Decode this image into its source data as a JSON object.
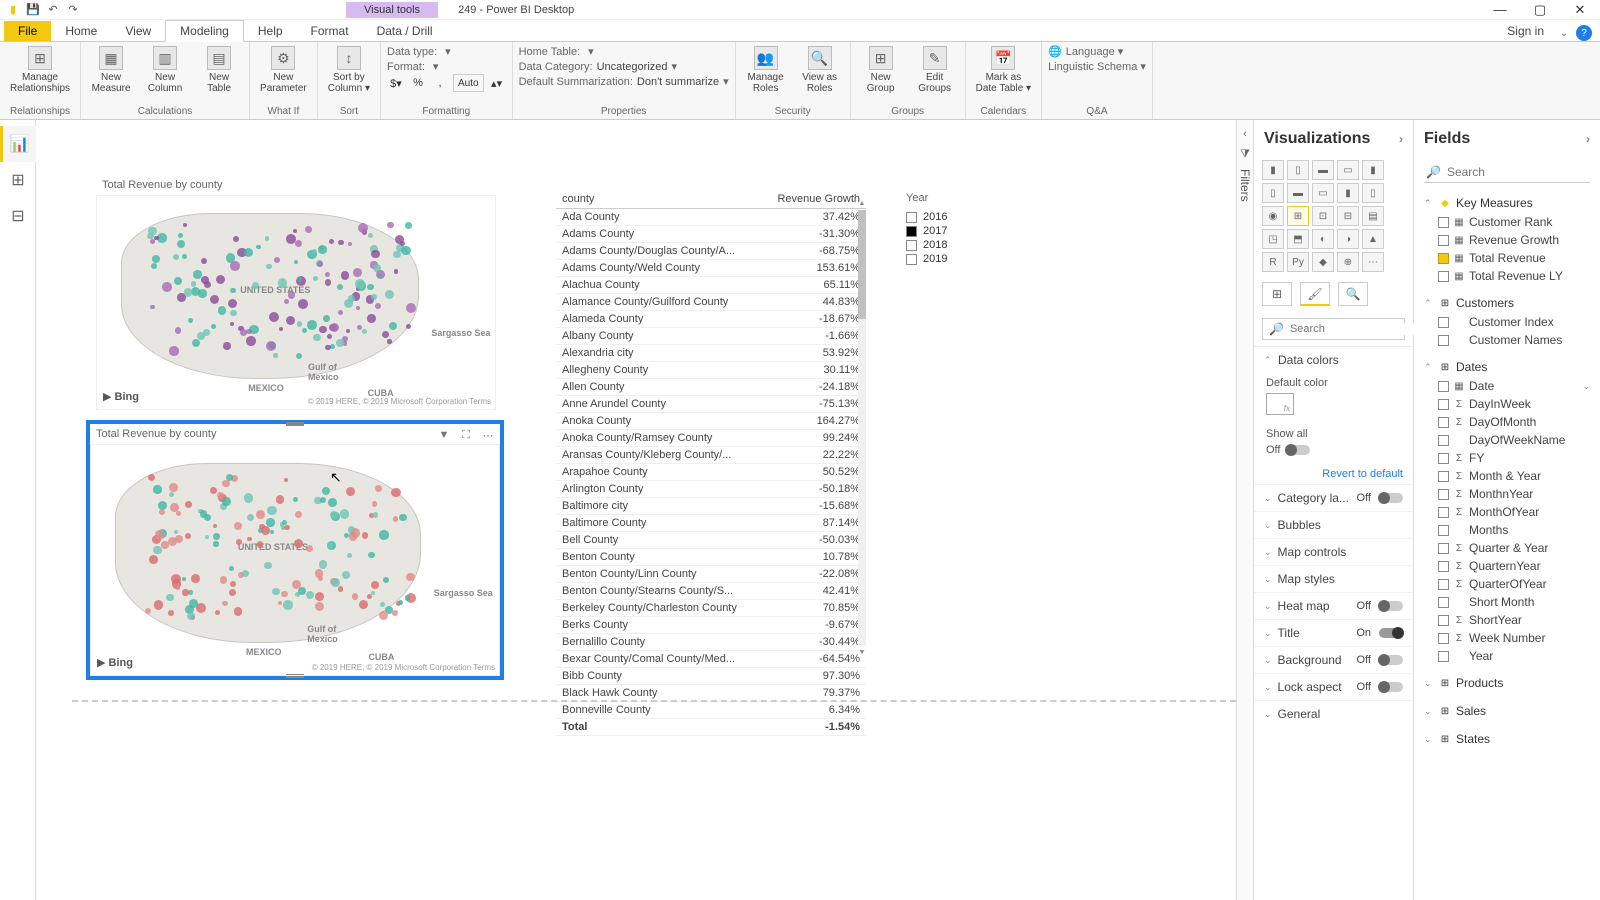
{
  "titlebar": {
    "visual_tools": "Visual tools",
    "app_title": "249 - Power BI Desktop"
  },
  "tabs": {
    "file": "File",
    "home": "Home",
    "view": "View",
    "modeling": "Modeling",
    "help": "Help",
    "format": "Format",
    "data_drill": "Data / Drill",
    "signin": "Sign in"
  },
  "ribbon": {
    "relationships": {
      "manage": "Manage\nRelationships",
      "group": "Relationships"
    },
    "calculations": {
      "measure": "New\nMeasure",
      "column": "New\nColumn",
      "table": "New\nTable",
      "group": "Calculations"
    },
    "whatif": {
      "param": "New\nParameter",
      "group": "What If"
    },
    "sort": {
      "sortby": "Sort by\nColumn ▾",
      "group": "Sort"
    },
    "formatting": {
      "datatype_lbl": "Data type:",
      "datatype_val": "",
      "format_lbl": "Format:",
      "format_val": "",
      "auto": "Auto",
      "group": "Formatting"
    },
    "properties": {
      "hometable_lbl": "Home Table:",
      "hometable_val": "",
      "datacat_lbl": "Data Category:",
      "datacat_val": "Uncategorized",
      "defsum_lbl": "Default Summarization:",
      "defsum_val": "Don't summarize",
      "group": "Properties"
    },
    "security": {
      "roles": "Manage\nRoles",
      "viewas": "View as\nRoles",
      "group": "Security"
    },
    "groups": {
      "new": "New\nGroup",
      "edit": "Edit\nGroups",
      "group": "Groups"
    },
    "calendars": {
      "mark": "Mark as\nDate Table ▾",
      "group": "Calendars"
    },
    "qa": {
      "lang": "Language ▾",
      "schema": "Linguistic Schema ▾",
      "group": "Q&A"
    }
  },
  "map_title": "Total Revenue by county",
  "map_labels": {
    "us": "UNITED STATES",
    "mexico": "MEXICO",
    "gulf": "Gulf of\nMexico",
    "cuba": "CUBA",
    "sargasso": "Sargasso Sea"
  },
  "bing": "Bing",
  "attrib": "© 2019 HERE, © 2019 Microsoft Corporation  Terms",
  "table": {
    "col1": "county",
    "col2": "Revenue Growth",
    "rows": [
      [
        "Ada County",
        "37.42%"
      ],
      [
        "Adams County",
        "-31.30%"
      ],
      [
        "Adams County/Douglas County/A...",
        "-68.75%"
      ],
      [
        "Adams County/Weld County",
        "153.61%"
      ],
      [
        "Alachua County",
        "65.11%"
      ],
      [
        "Alamance County/Guilford County",
        "44.83%"
      ],
      [
        "Alameda County",
        "-18.67%"
      ],
      [
        "Albany County",
        "-1.66%"
      ],
      [
        "Alexandria city",
        "53.92%"
      ],
      [
        "Allegheny County",
        "30.11%"
      ],
      [
        "Allen County",
        "-24.18%"
      ],
      [
        "Anne Arundel County",
        "-75.13%"
      ],
      [
        "Anoka County",
        "164.27%"
      ],
      [
        "Anoka County/Ramsey County",
        "99.24%"
      ],
      [
        "Aransas County/Kleberg County/...",
        "22.22%"
      ],
      [
        "Arapahoe County",
        "50.52%"
      ],
      [
        "Arlington County",
        "-50.18%"
      ],
      [
        "Baltimore city",
        "-15.68%"
      ],
      [
        "Baltimore County",
        "87.14%"
      ],
      [
        "Bell County",
        "-50.03%"
      ],
      [
        "Benton County",
        "10.78%"
      ],
      [
        "Benton County/Linn County",
        "-22.08%"
      ],
      [
        "Benton County/Stearns County/S...",
        "42.41%"
      ],
      [
        "Berkeley County/Charleston County",
        "70.85%"
      ],
      [
        "Berks County",
        "-9.67%"
      ],
      [
        "Bernalillo County",
        "-30.44%"
      ],
      [
        "Bexar County/Comal County/Med...",
        "-64.54%"
      ],
      [
        "Bibb County",
        "97.30%"
      ],
      [
        "Black Hawk County",
        "79.37%"
      ],
      [
        "Bonneville County",
        "6.34%"
      ]
    ],
    "total_lbl": "Total",
    "total_val": "-1.54%"
  },
  "slicer": {
    "title": "Year",
    "items": [
      "2016",
      "2017",
      "2018",
      "2019"
    ]
  },
  "viz": {
    "title": "Visualizations",
    "search_ph": "Search",
    "data_colors": "Data colors",
    "default_color": "Default color",
    "show_all": "Show all",
    "off": "Off",
    "on": "On",
    "revert": "Revert to default",
    "sections": {
      "cat_labels": "Category la...",
      "bubbles": "Bubbles",
      "map_controls": "Map controls",
      "map_styles": "Map styles",
      "heat_map": "Heat map",
      "title": "Title",
      "background": "Background",
      "lock_aspect": "Lock aspect",
      "general": "General"
    }
  },
  "fields": {
    "title": "Fields",
    "search_ph": "Search",
    "tables": {
      "key_measures": {
        "name": "Key Measures",
        "items": [
          {
            "n": "Customer Rank",
            "i": "▦",
            "c": false
          },
          {
            "n": "Revenue Growth",
            "i": "▦",
            "c": false
          },
          {
            "n": "Total Revenue",
            "i": "▦",
            "c": true
          },
          {
            "n": "Total Revenue LY",
            "i": "▦",
            "c": false
          }
        ]
      },
      "customers": {
        "name": "Customers",
        "items": [
          {
            "n": "Customer Index",
            "i": "",
            "c": false
          },
          {
            "n": "Customer Names",
            "i": "",
            "c": false
          }
        ]
      },
      "dates": {
        "name": "Dates",
        "items": [
          {
            "n": "Date",
            "i": "▦",
            "c": false,
            "exp": true
          },
          {
            "n": "DayInWeek",
            "i": "Σ",
            "c": false
          },
          {
            "n": "DayOfMonth",
            "i": "Σ",
            "c": false
          },
          {
            "n": "DayOfWeekName",
            "i": "",
            "c": false
          },
          {
            "n": "FY",
            "i": "Σ",
            "c": false
          },
          {
            "n": "Month & Year",
            "i": "Σ",
            "c": false
          },
          {
            "n": "MonthnYear",
            "i": "Σ",
            "c": false
          },
          {
            "n": "MonthOfYear",
            "i": "Σ",
            "c": false
          },
          {
            "n": "Months",
            "i": "",
            "c": false
          },
          {
            "n": "Quarter & Year",
            "i": "Σ",
            "c": false
          },
          {
            "n": "QuarternYear",
            "i": "Σ",
            "c": false
          },
          {
            "n": "QuarterOfYear",
            "i": "Σ",
            "c": false
          },
          {
            "n": "Short Month",
            "i": "",
            "c": false
          },
          {
            "n": "ShortYear",
            "i": "Σ",
            "c": false
          },
          {
            "n": "Week Number",
            "i": "Σ",
            "c": false
          },
          {
            "n": "Year",
            "i": "",
            "c": false
          }
        ]
      },
      "products": {
        "name": "Products"
      },
      "sales": {
        "name": "Sales"
      },
      "states": {
        "name": "States"
      }
    }
  }
}
